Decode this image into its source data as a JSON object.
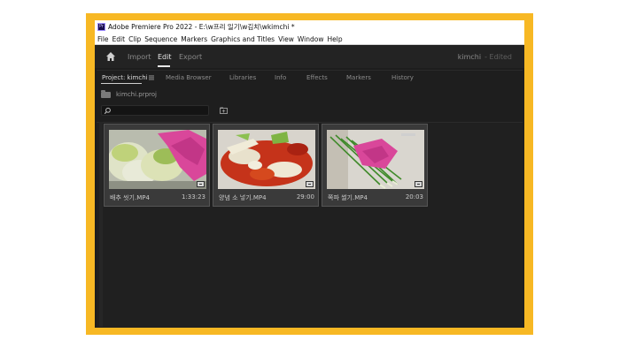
{
  "window": {
    "title": "Adobe Premiere Pro 2022 - E:\\w프리 일기\\w김치\\wkimchi *",
    "app_icon": "Pr"
  },
  "menu": [
    "File",
    "Edit",
    "Clip",
    "Sequence",
    "Markers",
    "Graphics and Titles",
    "View",
    "Window",
    "Help"
  ],
  "topnav": {
    "home_icon": "home-icon",
    "tabs": [
      "Import",
      "Edit",
      "Export"
    ],
    "active_tab": "Edit",
    "project_name": "kimchi",
    "status": "- Edited"
  },
  "panel": {
    "tabs": [
      "Project: kimchi",
      "Media Browser",
      "Libraries",
      "Info",
      "Effects",
      "Markers",
      "History"
    ],
    "active_tab": "Project: kimchi",
    "project_file": "kimchi.prproj",
    "search_value": "",
    "search_icon": "search-icon",
    "new_bin_icon": "new-bin-icon"
  },
  "clips": [
    {
      "name": "배추 씻기.MP4",
      "duration": "1:33:23",
      "thumb": "cabbage-wash"
    },
    {
      "name": "양념 소 넣기.MP4",
      "duration": "29:00",
      "thumb": "seasoning-stuffing"
    },
    {
      "name": "쪽파 썰기.MP4",
      "duration": "20:03",
      "thumb": "scallion-cutting"
    }
  ],
  "colors": {
    "frame": "#f7b824",
    "panel_bg": "#1e1e1e",
    "card_bg": "#3a3a3a"
  }
}
